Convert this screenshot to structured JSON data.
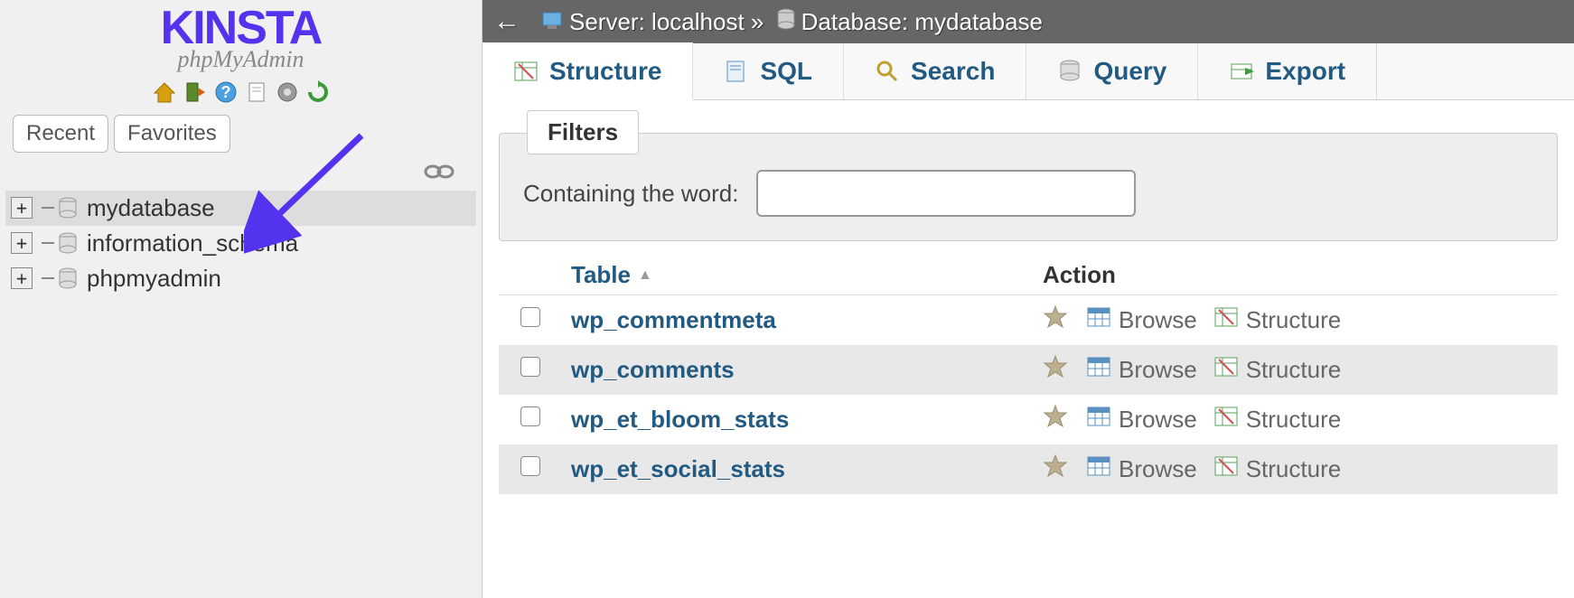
{
  "sidebar": {
    "logo_main": "KINSTA",
    "logo_sub": "phpMyAdmin",
    "tabs": {
      "recent": "Recent",
      "favorites": "Favorites"
    },
    "tree": [
      {
        "name": "mydatabase",
        "selected": true
      },
      {
        "name": "information_schema",
        "selected": false
      },
      {
        "name": "phpmyadmin",
        "selected": false
      }
    ]
  },
  "breadcrumb": {
    "server_label": "Server:",
    "server_name": "localhost",
    "separator": "»",
    "database_label": "Database:",
    "database_name": "mydatabase"
  },
  "tabs": [
    {
      "label": "Structure",
      "active": true,
      "icon": "structure"
    },
    {
      "label": "SQL",
      "active": false,
      "icon": "sql"
    },
    {
      "label": "Search",
      "active": false,
      "icon": "search"
    },
    {
      "label": "Query",
      "active": false,
      "icon": "query"
    },
    {
      "label": "Export",
      "active": false,
      "icon": "export"
    }
  ],
  "filters": {
    "legend": "Filters",
    "label": "Containing the word:"
  },
  "table_headers": {
    "table": "Table",
    "action": "Action"
  },
  "actions": {
    "browse": "Browse",
    "structure": "Structure"
  },
  "tables": [
    {
      "name": "wp_commentmeta"
    },
    {
      "name": "wp_comments"
    },
    {
      "name": "wp_et_bloom_stats"
    },
    {
      "name": "wp_et_social_stats"
    }
  ]
}
